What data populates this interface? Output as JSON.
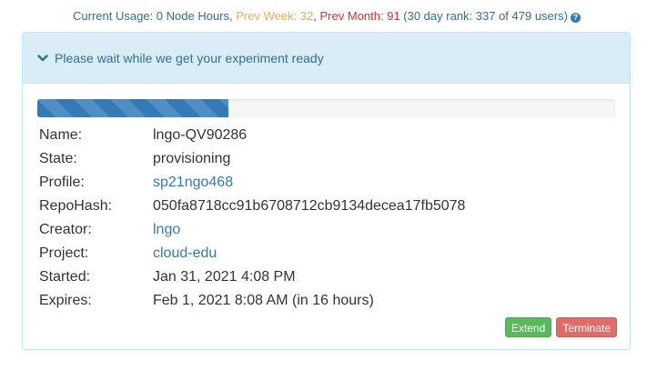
{
  "usage": {
    "current": "Current Usage: 0 Node Hours",
    "sep1": ", ",
    "prev_week": "Prev Week: 32",
    "sep2": ", ",
    "prev_month": "Prev Month: 91",
    "rank": " (30 day rank: 337 of 479 users)",
    "help_icon": "question-circle-icon"
  },
  "panel": {
    "heading": "Please wait while we get your experiment ready",
    "heading_icon": "chevron-down-icon",
    "progress_fraction": 0.33
  },
  "details": [
    {
      "label": "Name:",
      "value": "lngo-QV90286",
      "link": false
    },
    {
      "label": "State:",
      "value": "provisioning",
      "link": false
    },
    {
      "label": "Profile:",
      "value": "sp21ngo468",
      "link": true
    },
    {
      "label": "RepoHash:",
      "value": "050fa8718cc91b6708712cb9134decea17fb5078",
      "link": false
    },
    {
      "label": "Creator:",
      "value": "lngo",
      "link": true
    },
    {
      "label": "Project:",
      "value": "cloud-edu",
      "link": true
    },
    {
      "label": "Started:",
      "value": "Jan 31, 2021 4:08 PM",
      "link": false
    },
    {
      "label": "Expires:",
      "value": "Feb 1, 2021 8:08 AM (in 16 hours)",
      "link": false
    }
  ],
  "buttons": {
    "extend": "Extend",
    "terminate": "Terminate"
  },
  "colors": {
    "info": "#31708f",
    "week": "#f0ad4e",
    "month": "#d9302c",
    "link": "#337ab7",
    "success": "#5cb85c",
    "danger": "#d9534f"
  }
}
